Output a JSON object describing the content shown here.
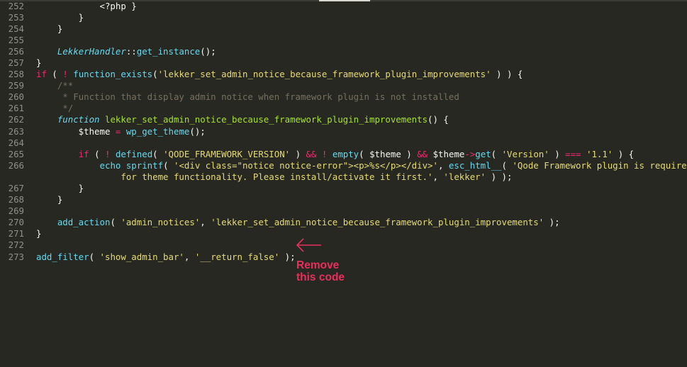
{
  "editor": {
    "theme_colors": {
      "background": "#272822",
      "keyword": "#f92672",
      "function": "#66d9ef",
      "string": "#e6db74",
      "comment": "#75715e",
      "text": "#f8f8f2",
      "line_number": "#90908a"
    },
    "lines": [
      {
        "num": "252",
        "tokens": [
          {
            "t": "            <?php }",
            "c": ""
          }
        ]
      },
      {
        "num": "253",
        "tokens": [
          {
            "t": "        }",
            "c": ""
          }
        ]
      },
      {
        "num": "254",
        "tokens": [
          {
            "t": "    }",
            "c": ""
          }
        ]
      },
      {
        "num": "255",
        "tokens": []
      },
      {
        "num": "256",
        "tokens": [
          {
            "t": "    ",
            "c": ""
          },
          {
            "t": "LekkerHandler",
            "c": "it"
          },
          {
            "t": "::",
            "c": ""
          },
          {
            "t": "get_instance",
            "c": "fn"
          },
          {
            "t": "();",
            "c": ""
          }
        ]
      },
      {
        "num": "257",
        "tokens": [
          {
            "t": "}",
            "c": ""
          }
        ]
      },
      {
        "num": "258",
        "tokens": [
          {
            "t": "if",
            "c": "kw"
          },
          {
            "t": " ( ",
            "c": ""
          },
          {
            "t": "!",
            "c": "kw"
          },
          {
            "t": " ",
            "c": ""
          },
          {
            "t": "function_exists",
            "c": "fn"
          },
          {
            "t": "(",
            "c": ""
          },
          {
            "t": "'lekker_set_admin_notice_because_framework_plugin_improvements'",
            "c": "st"
          },
          {
            "t": " ) ) {",
            "c": ""
          }
        ]
      },
      {
        "num": "259",
        "tokens": [
          {
            "t": "    /**",
            "c": "cm"
          }
        ]
      },
      {
        "num": "260",
        "tokens": [
          {
            "t": "     * Function that display admin notice when framework plugin is not installed",
            "c": "cm"
          }
        ]
      },
      {
        "num": "261",
        "tokens": [
          {
            "t": "     */",
            "c": "cm"
          }
        ]
      },
      {
        "num": "262",
        "tokens": [
          {
            "t": "    ",
            "c": ""
          },
          {
            "t": "function",
            "c": "it"
          },
          {
            "t": " lekker_set_admin_notice_because_framework_plugin_improvements",
            "c": "df"
          },
          {
            "t": "() {",
            "c": ""
          }
        ]
      },
      {
        "num": "263",
        "tokens": [
          {
            "t": "        $theme ",
            "c": ""
          },
          {
            "t": "=",
            "c": "kw"
          },
          {
            "t": " ",
            "c": ""
          },
          {
            "t": "wp_get_theme",
            "c": "fn"
          },
          {
            "t": "();",
            "c": ""
          }
        ]
      },
      {
        "num": "264",
        "tokens": []
      },
      {
        "num": "265",
        "tokens": [
          {
            "t": "        ",
            "c": ""
          },
          {
            "t": "if",
            "c": "kw"
          },
          {
            "t": " ( ",
            "c": ""
          },
          {
            "t": "!",
            "c": "kw"
          },
          {
            "t": " ",
            "c": ""
          },
          {
            "t": "defined",
            "c": "fn"
          },
          {
            "t": "( ",
            "c": ""
          },
          {
            "t": "'QODE_FRAMEWORK_VERSION'",
            "c": "st"
          },
          {
            "t": " ) ",
            "c": ""
          },
          {
            "t": "&&",
            "c": "kw"
          },
          {
            "t": " ",
            "c": ""
          },
          {
            "t": "!",
            "c": "kw"
          },
          {
            "t": " ",
            "c": ""
          },
          {
            "t": "empty",
            "c": "fn"
          },
          {
            "t": "( $theme ) ",
            "c": ""
          },
          {
            "t": "&&",
            "c": "kw"
          },
          {
            "t": " $theme",
            "c": ""
          },
          {
            "t": "->",
            "c": "kw"
          },
          {
            "t": "get",
            "c": "fn"
          },
          {
            "t": "( ",
            "c": ""
          },
          {
            "t": "'Version'",
            "c": "st"
          },
          {
            "t": " ) ",
            "c": ""
          },
          {
            "t": "===",
            "c": "kw"
          },
          {
            "t": " ",
            "c": ""
          },
          {
            "t": "'1.1'",
            "c": "st"
          },
          {
            "t": " ) {",
            "c": ""
          }
        ]
      },
      {
        "num": "266",
        "tokens": [
          {
            "t": "            ",
            "c": ""
          },
          {
            "t": "echo",
            "c": "fn"
          },
          {
            "t": " ",
            "c": ""
          },
          {
            "t": "sprintf",
            "c": "fn"
          },
          {
            "t": "( ",
            "c": ""
          },
          {
            "t": "'<div class=\"notice notice-error\"><p>%s</p></div>'",
            "c": "st"
          },
          {
            "t": ", ",
            "c": ""
          },
          {
            "t": "esc_html__",
            "c": "fn"
          },
          {
            "t": "( ",
            "c": ""
          },
          {
            "t": "'Qode Framework plugin is required",
            "c": "st"
          }
        ]
      },
      {
        "num": "",
        "tokens": [
          {
            "t": "                for theme functionality. Please install/activate it first.'",
            "c": "st"
          },
          {
            "t": ", ",
            "c": ""
          },
          {
            "t": "'lekker'",
            "c": "st"
          },
          {
            "t": " ) );",
            "c": ""
          }
        ]
      },
      {
        "num": "267",
        "tokens": [
          {
            "t": "        }",
            "c": ""
          }
        ]
      },
      {
        "num": "268",
        "tokens": [
          {
            "t": "    }",
            "c": ""
          }
        ]
      },
      {
        "num": "269",
        "tokens": []
      },
      {
        "num": "270",
        "tokens": [
          {
            "t": "    ",
            "c": ""
          },
          {
            "t": "add_action",
            "c": "fn"
          },
          {
            "t": "( ",
            "c": ""
          },
          {
            "t": "'admin_notices'",
            "c": "st"
          },
          {
            "t": ", ",
            "c": ""
          },
          {
            "t": "'lekker_set_admin_notice_because_framework_plugin_improvements'",
            "c": "st"
          },
          {
            "t": " );",
            "c": ""
          }
        ]
      },
      {
        "num": "271",
        "tokens": [
          {
            "t": "}",
            "c": ""
          }
        ]
      },
      {
        "num": "272",
        "tokens": []
      },
      {
        "num": "273",
        "tokens": [
          {
            "t": "add_filter",
            "c": "fn"
          },
          {
            "t": "( ",
            "c": ""
          },
          {
            "t": "'show_admin_bar'",
            "c": "st"
          },
          {
            "t": ", ",
            "c": ""
          },
          {
            "t": "'__return_false'",
            "c": "st"
          },
          {
            "t": " );",
            "c": ""
          }
        ]
      }
    ]
  },
  "annotation": {
    "line1": "Remove",
    "line2": "this code",
    "color": "#e8305c",
    "arrow_icon": "left-arrow"
  }
}
